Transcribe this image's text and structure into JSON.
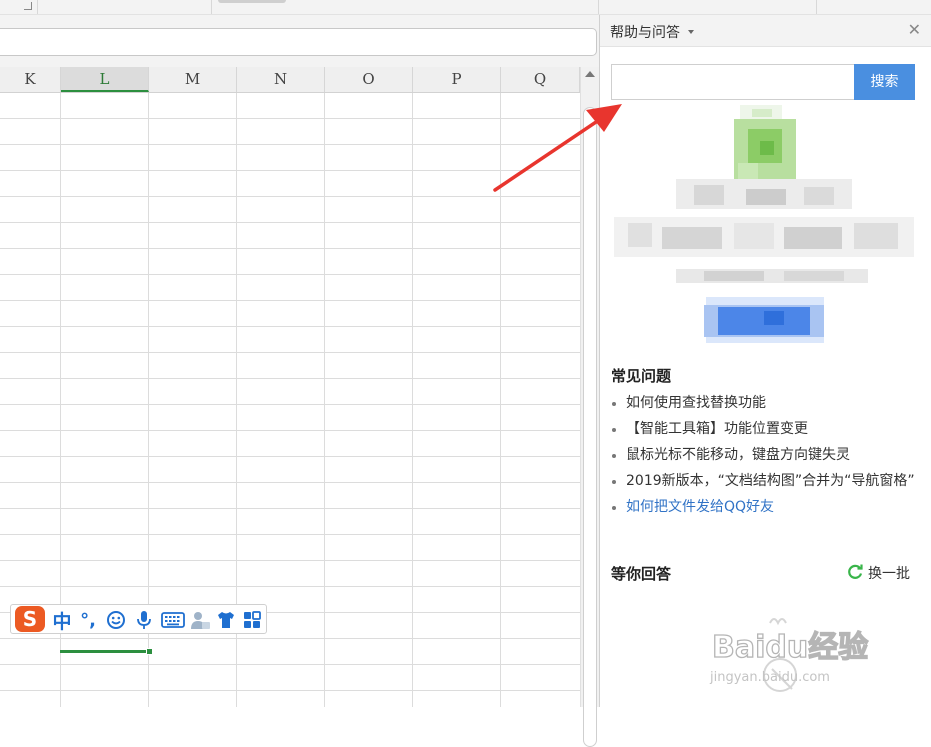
{
  "spreadsheet": {
    "columns": [
      "K",
      "L",
      "M",
      "N",
      "O",
      "P",
      "Q"
    ],
    "active_column": "L"
  },
  "ime_toolbar": {
    "logo": "S",
    "mode": "中",
    "punctuation": "°,",
    "icons": [
      "sogou-logo-icon",
      "emoji-icon",
      "microphone-icon",
      "keyboard-icon",
      "skin-person-icon",
      "tshirt-icon",
      "toolbox-grid-icon"
    ]
  },
  "help_panel": {
    "title": "帮助与问答",
    "search": {
      "placeholder": "",
      "button": "搜索"
    },
    "faq": {
      "heading": "常见问题",
      "items": [
        "如何使用查找替换功能",
        "【智能工具箱】功能位置变更",
        "鼠标光标不能移动，键盘方向键失灵",
        "2019新版本，“文档结构图”合并为“导航窗格”",
        "如何把文件发给QQ好友"
      ]
    },
    "waiting": {
      "heading": "等你回答",
      "refresh": "换一批"
    }
  },
  "watermark": {
    "brand": "Baidu经验",
    "url": "jingyan.baidu.com"
  },
  "colors": {
    "accent_green": "#2c8f3f",
    "search_blue": "#4a8fe0",
    "link_blue": "#3173c6",
    "arrow_red": "#e8352e",
    "ime_orange": "#ec5a23"
  }
}
